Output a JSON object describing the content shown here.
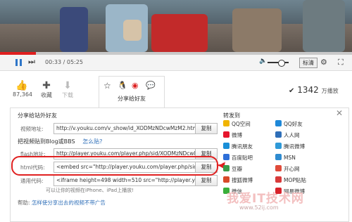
{
  "player": {
    "current_time": "00:33",
    "sep": "/",
    "total_time": "05:25",
    "progress_pct": 10.2,
    "volume_pct": 75,
    "quality_label": "标清"
  },
  "actions": {
    "like_count": "87,364",
    "favorite_label": "收藏",
    "download_label": "下载",
    "share_label": "分享给好友"
  },
  "views": {
    "count": "1342",
    "unit": "万播放"
  },
  "share_panel": {
    "title_share": "分享给站外好友",
    "video_url_label": "视频地址:",
    "video_url_value": "http://v.youku.com/v_show/id_XODMzNDcwMzM2.html",
    "embed_title": "把视频贴到Blog或BBS",
    "embed_help": "怎么贴?",
    "flash_label": "flash地址:",
    "flash_value": "http://player.youku.com/player.php/sid/XODMzNDcwMzM",
    "html_label": "html代码:",
    "html_value": "<embed src=\"http://player.youku.com/player.php/sid/XOD",
    "generic_label": "通用代码:",
    "generic_value": "<iframe height=498 width=510 src=\"http://player.youku.cc",
    "generic_note": "可以让你的视频在iPhone、iPad上播放!",
    "copy_label": "复制",
    "help_prefix": "帮助:",
    "help_link": "怎样使分享出去的视频不带广告",
    "forward_title": "转发到",
    "sites_left": [
      "QQ空间",
      "微博",
      "腾讯朋友",
      "百度贴吧",
      "豆瓣",
      "搜狐微博",
      "微信"
    ],
    "sites_right": [
      "QQ好友",
      "人人网",
      "腾讯微博",
      "MSN",
      "开心网",
      "MOP贴贴",
      "网易微博"
    ]
  },
  "watermark": {
    "text": "我爱IT技术网",
    "url": "www.52ij.com"
  },
  "colors": {
    "accent_red": "#e01f1f",
    "link_blue": "#2f6fb8",
    "site_left": [
      "#f0b400",
      "#e6162d",
      "#1a8fd8",
      "#2e6fd8",
      "#3a9d4a",
      "#d84a2a",
      "#3aae3a"
    ],
    "site_right": [
      "#1e88d8",
      "#2f6fb8",
      "#2f9ad8",
      "#2e8bd0",
      "#e04b3a",
      "#d83a3a",
      "#d8222a"
    ]
  }
}
